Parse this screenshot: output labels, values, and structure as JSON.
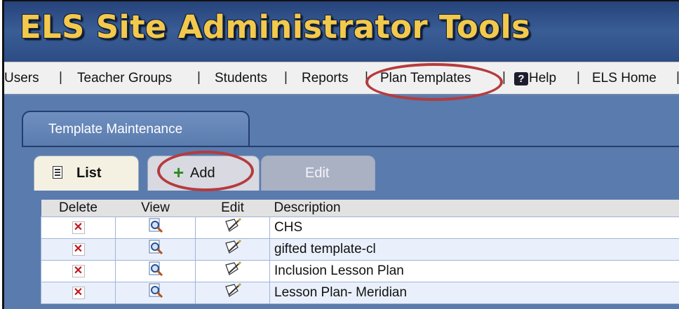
{
  "header": {
    "title": "ELS Site Administrator Tools"
  },
  "nav": {
    "users": "Users",
    "teacher_groups": "Teacher Groups",
    "students": "Students",
    "reports": "Reports",
    "plan_templates": "Plan Templates",
    "help": "Help",
    "els_home": "ELS Home",
    "separator": "|",
    "help_glyph": "?"
  },
  "main_tab": {
    "label": "Template Maintenance"
  },
  "subtabs": {
    "list": "List",
    "add": "Add",
    "add_glyph": "+",
    "edit": "Edit"
  },
  "table": {
    "headers": {
      "delete": "Delete",
      "view": "View",
      "edit": "Edit",
      "description": "Description"
    },
    "rows": [
      {
        "description": "CHS"
      },
      {
        "description": "gifted template-cl"
      },
      {
        "description": "Inclusion Lesson Plan"
      },
      {
        "description": "Lesson Plan- Meridian"
      }
    ],
    "delete_glyph": "✕"
  },
  "icons": {
    "list": "list-icon",
    "add": "plus-icon",
    "help": "help-icon",
    "delete": "delete-icon",
    "view": "magnifier-icon",
    "edit": "pencil-icon"
  },
  "colors": {
    "title": "#f2c94c",
    "header_bg": "#2d4c84",
    "highlight": "#b53b3d",
    "delete": "#c0171c",
    "add": "#2e8b1e"
  }
}
